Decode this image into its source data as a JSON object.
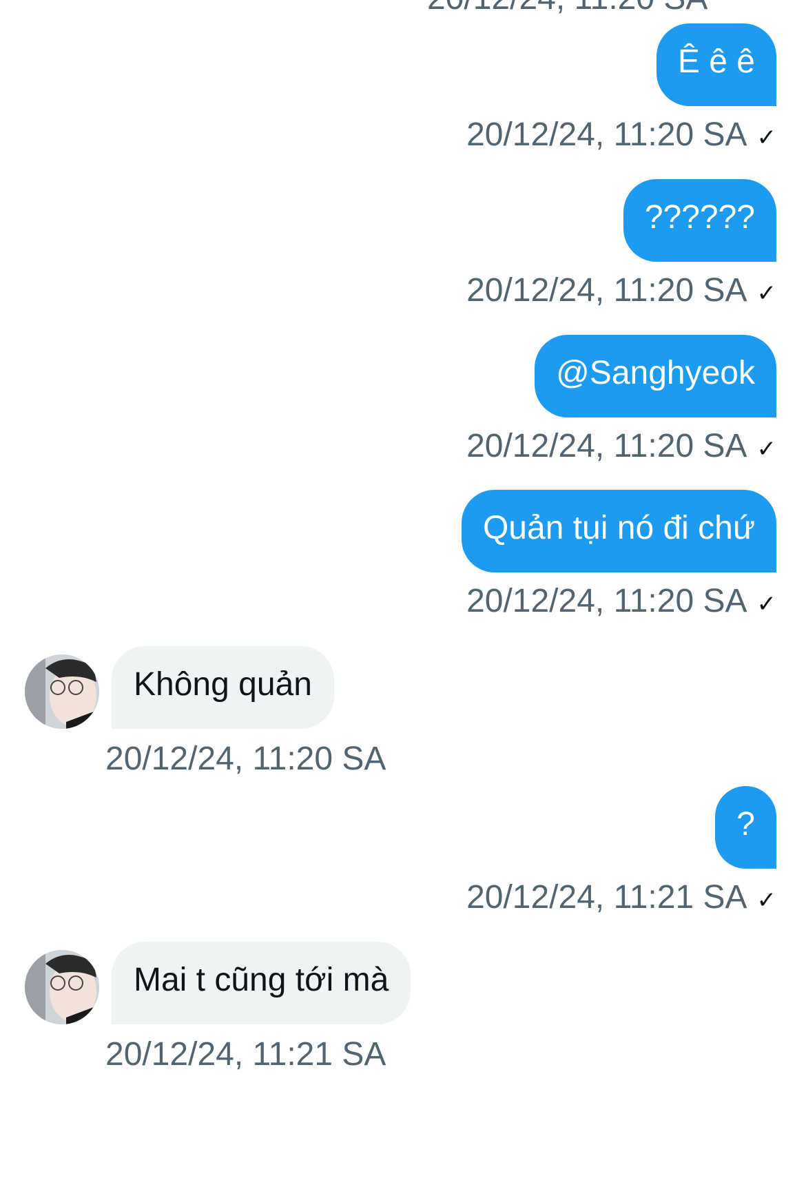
{
  "conversation": {
    "cutoff_timestamp": "20/12/24, 11:20 SA",
    "messages": [
      {
        "direction": "outgoing",
        "text": "Ê ê ê",
        "timestamp": "20/12/24, 11:20 SA",
        "status_icon": "checkmark-icon"
      },
      {
        "direction": "outgoing",
        "text": "??????",
        "timestamp": "20/12/24, 11:20 SA",
        "status_icon": "checkmark-icon"
      },
      {
        "direction": "outgoing",
        "text": "@Sanghyeok",
        "timestamp": "20/12/24, 11:20 SA",
        "status_icon": "checkmark-icon"
      },
      {
        "direction": "outgoing",
        "text": "Quản tụi nó đi chứ",
        "timestamp": "20/12/24, 11:20 SA",
        "status_icon": "checkmark-icon"
      },
      {
        "direction": "incoming",
        "text": "Không quản",
        "timestamp": "20/12/24, 11:20 SA",
        "avatar": "user-avatar"
      },
      {
        "direction": "outgoing",
        "text": "?",
        "timestamp": "20/12/24, 11:21 SA",
        "status_icon": "checkmark-icon"
      },
      {
        "direction": "incoming",
        "text": "Mai t cũng tới mà",
        "timestamp": "20/12/24, 11:21 SA",
        "avatar": "user-avatar"
      }
    ]
  },
  "theme": {
    "outgoing_bubble": "#1d9bf0",
    "incoming_bubble": "#eff3f4",
    "timestamp_color": "#536471",
    "text_color": "#0f1419"
  },
  "status_glyph": "✓"
}
